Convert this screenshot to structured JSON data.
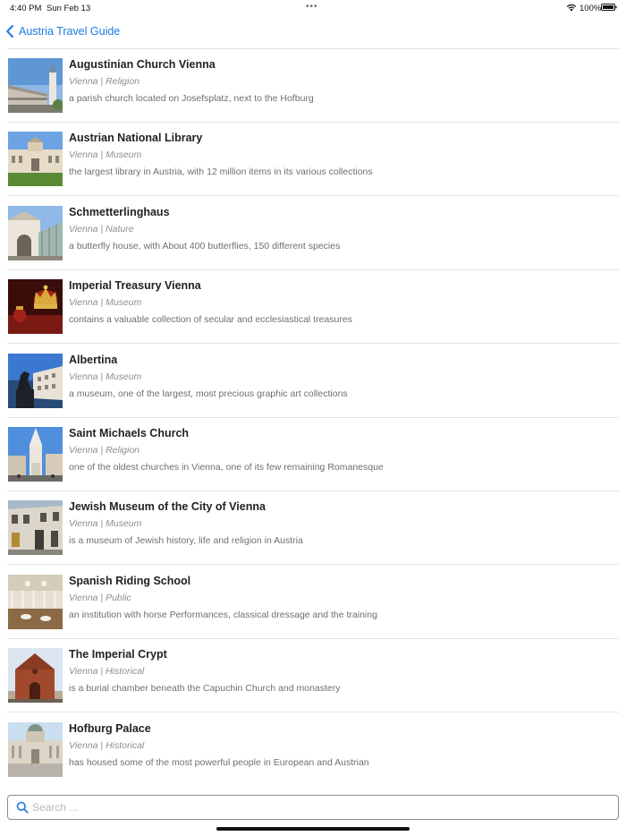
{
  "status_bar": {
    "time": "4:40 PM",
    "date": "Sun Feb 13",
    "dots": "•••",
    "battery": "100%"
  },
  "nav": {
    "back_label": "Austria Travel Guide",
    "accent": "#1b7ae0"
  },
  "places": [
    {
      "title": "Augustinian Church Vienna",
      "subtitle": "Vienna | Religion",
      "description": "a parish church located on Josefsplatz, next to the Hofburg"
    },
    {
      "title": "Austrian National Library",
      "subtitle": "Vienna | Museum",
      "description": "the largest library in Austria, with 12 million items in its various collections"
    },
    {
      "title": "Schmetterlinghaus",
      "subtitle": "Vienna | Nature",
      "description": "a butterfly house, with About 400 butterflies, 150 different species"
    },
    {
      "title": "Imperial Treasury Vienna",
      "subtitle": "Vienna | Museum",
      "description": "contains a valuable collection of secular and ecclesiastical treasures"
    },
    {
      "title": "Albertina",
      "subtitle": "Vienna | Museum",
      "description": "a museum, one of the largest, most precious graphic art collections"
    },
    {
      "title": "Saint Michaels Church",
      "subtitle": "Vienna | Religion",
      "description": "one of the oldest churches in Vienna, one of its few remaining Romanesque"
    },
    {
      "title": "Jewish Museum of the City of Vienna",
      "subtitle": "Vienna | Museum",
      "description": "is a museum of Jewish history, life and religion in Austria"
    },
    {
      "title": "Spanish Riding School",
      "subtitle": "Vienna | Public",
      "description": "an institution with horse Performances, classical dressage and the training"
    },
    {
      "title": "The Imperial Crypt",
      "subtitle": "Vienna | Historical",
      "description": "is a burial chamber beneath the Capuchin Church and monastery"
    },
    {
      "title": "Hofburg Palace",
      "subtitle": "Vienna | Historical",
      "description": "has housed some of the most powerful people in European and Austrian"
    }
  ],
  "search": {
    "placeholder": "Search ...",
    "value": ""
  }
}
